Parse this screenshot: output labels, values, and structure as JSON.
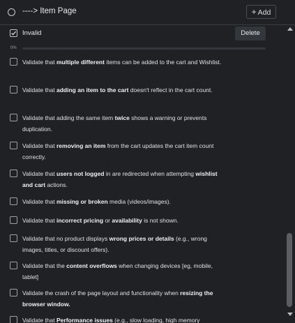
{
  "header": {
    "title": "----> Item Page",
    "add_label": "Add"
  },
  "checklist": {
    "name": "Invalid",
    "delete_label": "Delete",
    "progress_text": "0%",
    "progress_fraction": 0
  },
  "items": [
    {
      "segments": [
        {
          "t": "Validate that "
        },
        {
          "t": "multiple different",
          "b": true
        },
        {
          "t": " items can be added to the cart and Wishlist."
        }
      ]
    },
    {
      "segments": [
        {
          "t": "Validate that "
        },
        {
          "t": "adding an item to the cart",
          "b": true
        },
        {
          "t": " doesn't reflect in the cart count."
        }
      ]
    },
    {
      "segments": [
        {
          "t": "Validate that adding the same item "
        },
        {
          "t": "twice",
          "b": true
        },
        {
          "t": " shows a warning or prevents duplication."
        }
      ]
    },
    {
      "segments": [
        {
          "t": "Validate that "
        },
        {
          "t": "removing an item",
          "b": true
        },
        {
          "t": " from the cart updates the cart item count correctly."
        }
      ]
    },
    {
      "segments": [
        {
          "t": "Validate that "
        },
        {
          "t": "users not logged",
          "b": true
        },
        {
          "t": " in are redirected when attempting "
        },
        {
          "t": "wishlist and cart",
          "b": true
        },
        {
          "t": " actions."
        }
      ]
    },
    {
      "segments": [
        {
          "t": "Validate that "
        },
        {
          "t": "missing or broken",
          "b": true
        },
        {
          "t": " media (videos/images)."
        }
      ]
    },
    {
      "segments": [
        {
          "t": "Validate that "
        },
        {
          "t": "incorrect pricing",
          "b": true
        },
        {
          "t": " or "
        },
        {
          "t": "availability",
          "b": true
        },
        {
          "t": " is not shown."
        }
      ]
    },
    {
      "segments": [
        {
          "t": "Validate that no product displays "
        },
        {
          "t": "wrong prices or details",
          "b": true
        },
        {
          "t": " (e.g., wrong images, titles, or discount offers)."
        }
      ]
    },
    {
      "segments": [
        {
          "t": "Validate that the "
        },
        {
          "t": "content overflows",
          "b": true
        },
        {
          "t": " when changing devices [eg, mobile, tablet]"
        }
      ]
    },
    {
      "segments": [
        {
          "t": "Validate the crash of the page layout and functionality when "
        },
        {
          "t": "resizing the browser window.",
          "b": true
        }
      ]
    },
    {
      "segments": [
        {
          "t": "Validate that "
        },
        {
          "t": "Performance issues",
          "b": true
        },
        {
          "t": " (e.g., slow loading, high memory"
        }
      ]
    }
  ]
}
